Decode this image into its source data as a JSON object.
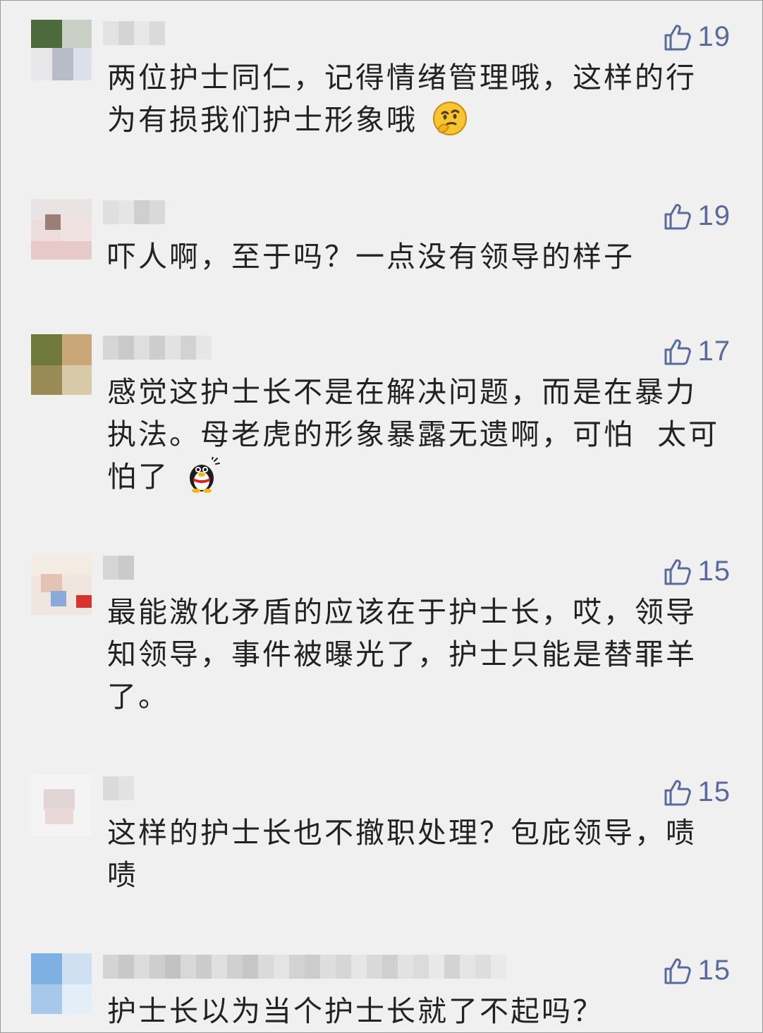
{
  "comments": [
    {
      "likes": "19",
      "text_lines": [
        "两位护士同仁，记得情绪管理哦，这样的行",
        "为有损我们护士形象哦"
      ],
      "emoji": "thinking-face-emoji"
    },
    {
      "likes": "19",
      "text_lines": [
        "吓人啊，至于吗？一点没有领导的样子"
      ],
      "emoji": ""
    },
    {
      "likes": "17",
      "text_lines": [
        "感觉这护士长不是在解决问题，而是在暴力",
        "执法。母老虎的形象暴露无遗啊，可怕  太可",
        "怕了"
      ],
      "emoji": "qq-penguin-scared-emoji"
    },
    {
      "likes": "15",
      "text_lines": [
        "最能激化矛盾的应该在于护士长，哎，领导",
        "知领导，事件被曝光了，护士只能是替罪羊",
        "了。"
      ],
      "emoji": ""
    },
    {
      "likes": "15",
      "text_lines": [
        "这样的护士长也不撤职处理？包庇领导，啧",
        "啧"
      ],
      "emoji": ""
    },
    {
      "likes": "15",
      "text_lines": [
        "护士长以为当个护士长就了不起吗？"
      ],
      "emoji": ""
    }
  ],
  "icons": {
    "like": "thumbs-up-outline-icon"
  },
  "colors": {
    "background": "#f0f0f0",
    "text": "#222222",
    "like": "#5a6a9a"
  }
}
